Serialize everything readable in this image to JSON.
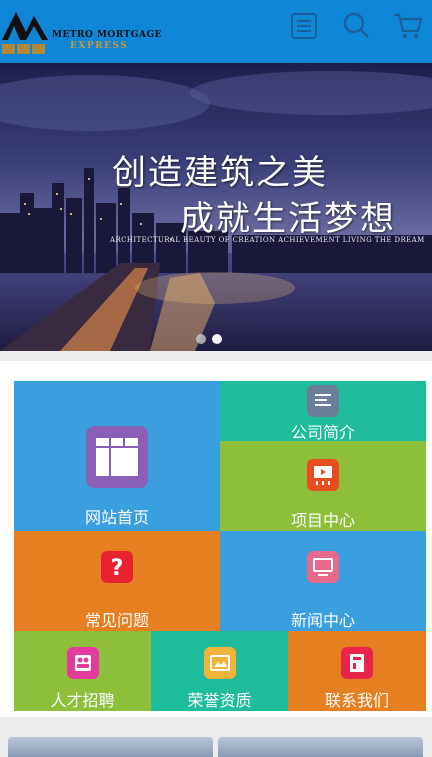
{
  "logo": {
    "line1": "METRO MORTGAGE",
    "line2": "EXPRESS"
  },
  "header": {
    "icons": [
      "menu-list-icon",
      "search-icon",
      "cart-icon"
    ]
  },
  "colors": {
    "header_bg": "#0f86d6",
    "tile_blue": "#3a9fdf",
    "tile_teal": "#1fbc9c",
    "tile_green": "#8dbf3a",
    "tile_orange": "#e67e22"
  },
  "banner": {
    "title_line1": "创造建筑之美",
    "title_line2": "成就生活梦想",
    "subtitle": "ARCHITECTURAL BEAUTY OF CREATION ACHIEVEMENT LIVING THE DREAM",
    "slides": 2,
    "active_slide": 2
  },
  "nav": {
    "home": "网站首页",
    "about": "公司简介",
    "projects": "项目中心",
    "faq": "常见问题",
    "news": "新闻中心",
    "jobs": "人才招聘",
    "honors": "荣誉资质",
    "contact": "联系我们"
  }
}
